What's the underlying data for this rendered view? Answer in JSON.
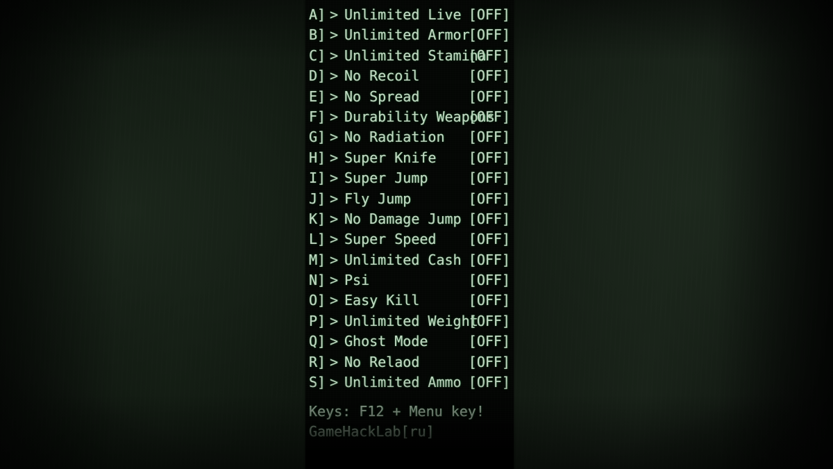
{
  "overlay": {
    "type": "game-trainer-cheat-menu",
    "panel_bg_color": "#040604",
    "text_color": "#c3d6c3",
    "accent_glow_color": "#4e9a5e",
    "background_color": "#131c13"
  },
  "menu": {
    "items": [
      {
        "key": "A]",
        "arrow": ">",
        "label": "Unlimited Live",
        "state": "[OFF]"
      },
      {
        "key": "B]",
        "arrow": ">",
        "label": "Unlimited Armor",
        "state": "[OFF]"
      },
      {
        "key": "C]",
        "arrow": ">",
        "label": "Unlimited Stamina",
        "state": "[OFF]"
      },
      {
        "key": "D]",
        "arrow": ">",
        "label": "No Recoil",
        "state": "[OFF]"
      },
      {
        "key": "E]",
        "arrow": ">",
        "label": "No Spread",
        "state": "[OFF]"
      },
      {
        "key": "F]",
        "arrow": ">",
        "label": "Durability Weapons",
        "state": "[OFF]"
      },
      {
        "key": "G]",
        "arrow": ">",
        "label": "No Radiation",
        "state": "[OFF]"
      },
      {
        "key": "H]",
        "arrow": ">",
        "label": "Super Knife",
        "state": "[OFF]"
      },
      {
        "key": "I]",
        "arrow": ">",
        "label": "Super Jump",
        "state": "[OFF]"
      },
      {
        "key": "J]",
        "arrow": ">",
        "label": "Fly Jump",
        "state": "[OFF]"
      },
      {
        "key": "K]",
        "arrow": ">",
        "label": "No Damage Jump",
        "state": "[OFF]"
      },
      {
        "key": "L]",
        "arrow": ">",
        "label": "Super Speed",
        "state": "[OFF]"
      },
      {
        "key": "M]",
        "arrow": ">",
        "label": "Unlimited Cash",
        "state": "[OFF]"
      },
      {
        "key": "N]",
        "arrow": ">",
        "label": "Psi",
        "state": "[OFF]"
      },
      {
        "key": "O]",
        "arrow": ">",
        "label": "Easy Kill",
        "state": "[OFF]"
      },
      {
        "key": "P]",
        "arrow": ">",
        "label": "Unlimited Weight",
        "state": "[OFF]"
      },
      {
        "key": "Q]",
        "arrow": ">",
        "label": "Ghost Mode",
        "state": "[OFF]"
      },
      {
        "key": "R]",
        "arrow": ">",
        "label": "No Relaod",
        "state": "[OFF]"
      },
      {
        "key": "S]",
        "arrow": ">",
        "label": "Unlimited Ammo",
        "state": "[OFF]"
      }
    ]
  },
  "footer": {
    "keys_hint": "Keys: F12 + Menu key!",
    "credit": "GameHackLab[ru]"
  }
}
